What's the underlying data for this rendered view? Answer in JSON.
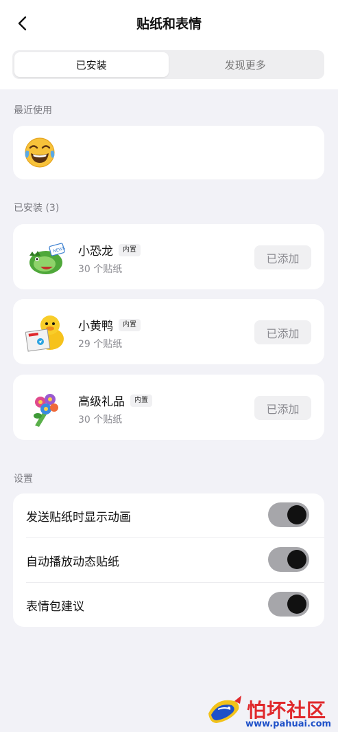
{
  "header": {
    "title": "贴纸和表情"
  },
  "tabs": [
    {
      "label": "已安装",
      "active": true
    },
    {
      "label": "发现更多",
      "active": false
    }
  ],
  "recent": {
    "label": "最近使用",
    "items": [
      "😂"
    ]
  },
  "installed": {
    "label": "已安装 (3)",
    "packs": [
      {
        "name": "小恐龙",
        "badge": "内置",
        "count": "30 个贴纸",
        "button": "已添加",
        "icon": "dinosaur-sticker"
      },
      {
        "name": "小黄鸭",
        "badge": "内置",
        "count": "29 个贴纸",
        "button": "已添加",
        "icon": "duck-sticker"
      },
      {
        "name": "高级礼品",
        "badge": "内置",
        "count": "30 个贴纸",
        "button": "已添加",
        "icon": "bouquet-sticker"
      }
    ]
  },
  "settings": {
    "label": "设置",
    "items": [
      {
        "label": "发送贴纸时显示动画",
        "on": true
      },
      {
        "label": "自动播放动态贴纸",
        "on": true
      },
      {
        "label": "表情包建议",
        "on": true
      }
    ]
  },
  "watermark": {
    "title": "怕坏社区",
    "url": "www.pahuai.com"
  },
  "colors": {
    "background": "#f2f2f7",
    "card": "#ffffff",
    "toggle_track": "#a6a6aa",
    "toggle_knob": "#111111",
    "watermark_red": "#e0282b",
    "watermark_blue": "#1e50c8"
  }
}
